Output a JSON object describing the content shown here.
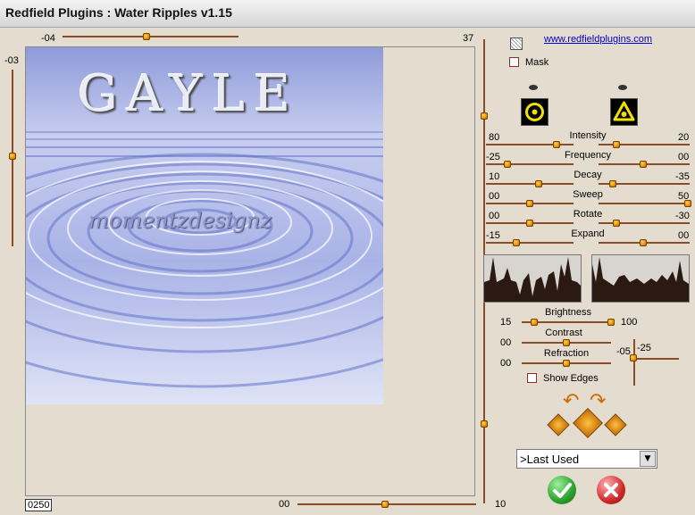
{
  "window": {
    "title": "Redfield Plugins : Water Ripples v1.15"
  },
  "top_slider": {
    "left_value": "-04",
    "right_value": "37",
    "level": 0.48
  },
  "left_slider": {
    "value": "-03",
    "level": 0.48
  },
  "bottom_slider": {
    "value": "00",
    "right_value": "10",
    "level": 0.5
  },
  "preview": {
    "title_text": "GAYLE",
    "watermark_text": "momentzdesignz",
    "zoom": "0250"
  },
  "panel": {
    "link": "www.redfieldplugins.com",
    "mask_label": "Mask",
    "params": [
      {
        "name": "Intensity",
        "left": "80",
        "right": "20"
      },
      {
        "name": "Frequency",
        "left": "-25",
        "right": "00"
      },
      {
        "name": "Decay",
        "left": "10",
        "right": "-35"
      },
      {
        "name": "Sweep",
        "left": "00",
        "right": "50"
      },
      {
        "name": "Rotate",
        "left": "00",
        "right": "-30"
      },
      {
        "name": "Expand",
        "left": "-15",
        "right": "00"
      }
    ],
    "brightness": {
      "label": "Brightness",
      "left": "15",
      "right": "100"
    },
    "contrast": {
      "label": "Contrast",
      "left": "00"
    },
    "refraction": {
      "label": "Refraction",
      "left": "00"
    },
    "light_xy": {
      "x": "-05",
      "y": "-25"
    },
    "show_edges_label": "Show Edges",
    "preset": {
      "selected": ">Last Used"
    }
  },
  "colors": {
    "accent": "#e89000",
    "ok": "#2ea02e",
    "cancel": "#d02a2a",
    "water": "#7e8fd6"
  }
}
